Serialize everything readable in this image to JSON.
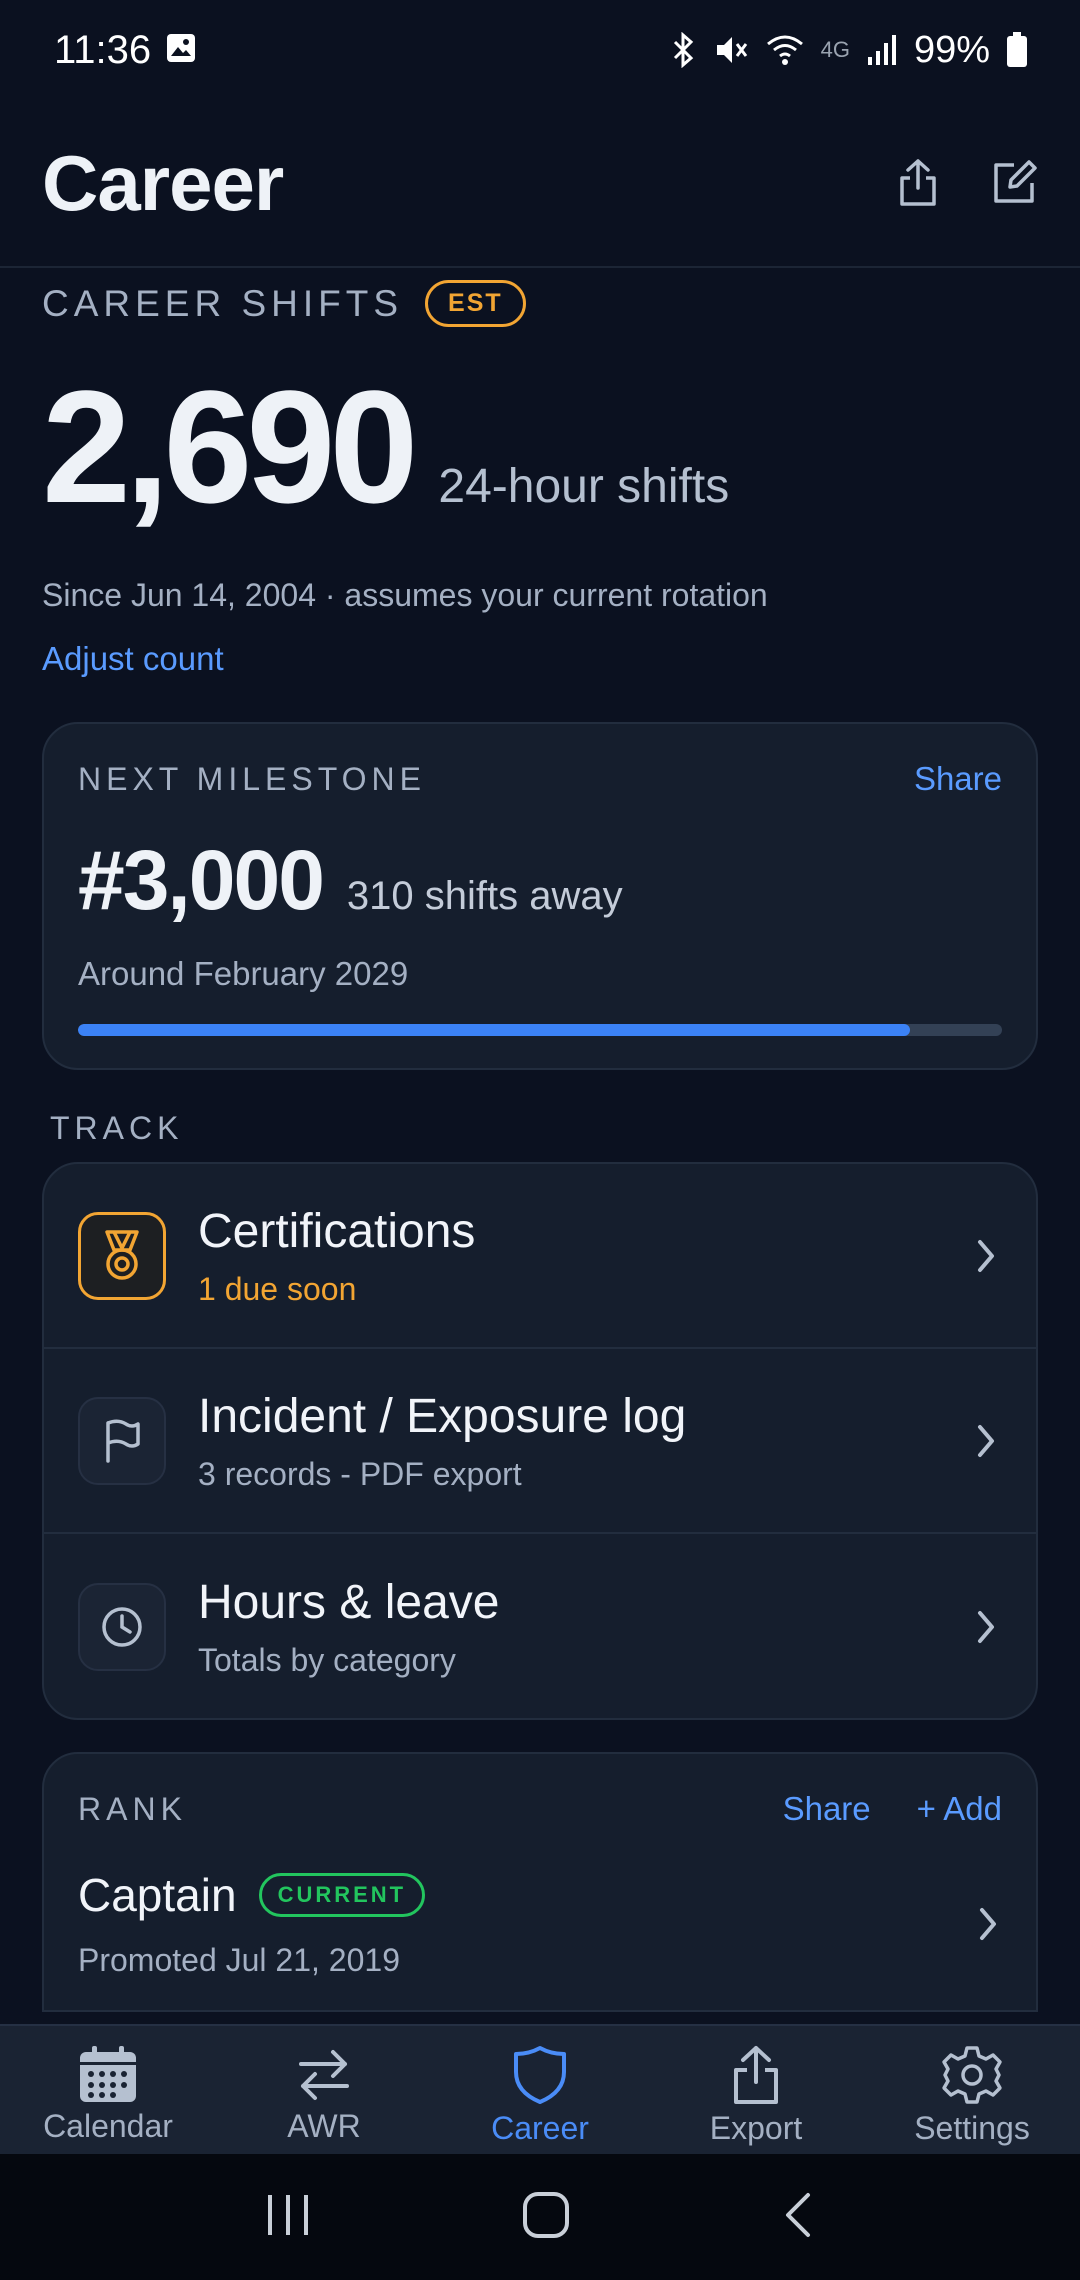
{
  "status_bar": {
    "time": "11:36",
    "battery": "99%",
    "network": "4G"
  },
  "header": {
    "title": "Career",
    "share_icon": "share-icon",
    "edit_icon": "edit-icon"
  },
  "career_shifts": {
    "label": "CAREER SHIFTS",
    "badge": "EST",
    "count": "2,690",
    "unit": "24-hour shifts",
    "since": "Since Jun 14, 2004 · assumes your current rotation",
    "adjust_link": "Adjust count"
  },
  "milestone": {
    "label": "NEXT MILESTONE",
    "share": "Share",
    "number": "#3,000",
    "away": "310 shifts away",
    "date": "Around February 2029",
    "progress": 0.9,
    "progress_color": "#3b82f6"
  },
  "track": {
    "label": "TRACK",
    "items": [
      {
        "title": "Certifications",
        "subtitle": "1 due soon",
        "icon": "medal-icon"
      },
      {
        "title": "Incident / Exposure log",
        "subtitle": "3 records - PDF export",
        "icon": "flag-icon"
      },
      {
        "title": "Hours & leave",
        "subtitle": "Totals by category",
        "icon": "clock-icon"
      }
    ]
  },
  "rank": {
    "label": "RANK",
    "share": "Share",
    "add": "+ Add",
    "title": "Captain",
    "badge": "CURRENT",
    "promoted": "Promoted Jul 21, 2019"
  },
  "tabs": [
    {
      "label": "Calendar",
      "icon": "calendar-icon",
      "active": false
    },
    {
      "label": "AWR",
      "icon": "swap-icon",
      "active": false
    },
    {
      "label": "Career",
      "icon": "shield-icon",
      "active": true
    },
    {
      "label": "Export",
      "icon": "share-icon",
      "active": false
    },
    {
      "label": "Settings",
      "icon": "gear-icon",
      "active": false
    }
  ],
  "colors": {
    "background": "#0b1120",
    "card": "#151e2d",
    "accent": "#5a9bff",
    "warning": "#f2a533",
    "success": "#22c55e"
  }
}
